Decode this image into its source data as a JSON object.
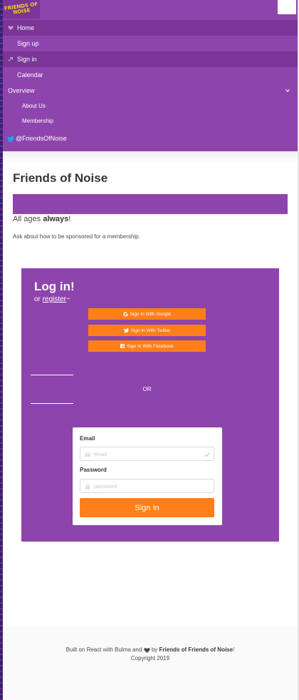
{
  "brand": {
    "logo_text": "FRIENDS OF NOISE",
    "accent": "#8e44ad",
    "button": "#ff7f1a"
  },
  "nav": {
    "items": [
      {
        "label": "Home",
        "icon": "heart-icon",
        "active": true
      },
      {
        "label": "Sign up",
        "icon": "",
        "active": false
      },
      {
        "label": "Sign in",
        "icon": "arrow-icon",
        "active": true
      },
      {
        "label": "Calendar",
        "icon": "",
        "active": false
      }
    ],
    "overview": "Overview",
    "sub_items": [
      "About Us",
      "Membership"
    ],
    "twitter": "@FriendsOfNoise"
  },
  "hero": {
    "title": "Friends of Noise",
    "tagline_prefix": "All ages ",
    "tagline_bold": "always",
    "tagline_suffix": "!",
    "sponsor_text": "Ask about how to be sponsored for a membership."
  },
  "login": {
    "title": "Log in!",
    "sub_prefix": "or ",
    "register_link": "register",
    "sub_suffix": "~",
    "social": [
      {
        "label": "Sign In With Google",
        "icon": "google-icon"
      },
      {
        "label": "Sign In With Twitter",
        "icon": "twitter-icon"
      },
      {
        "label": "Sign In With Facebook",
        "icon": "facebook-icon"
      }
    ],
    "or_text": "OR",
    "email_label": "Email",
    "email_placeholder": "email",
    "password_label": "Password",
    "password_placeholder": "password",
    "submit": "Sign In"
  },
  "footer": {
    "line1_prefix": "Built on React with Bulma and ",
    "line1_by": " by ",
    "line1_org": "Friends of Friends of Noise",
    "line1_suffix": "!",
    "copyright": "Copyright 2019"
  }
}
